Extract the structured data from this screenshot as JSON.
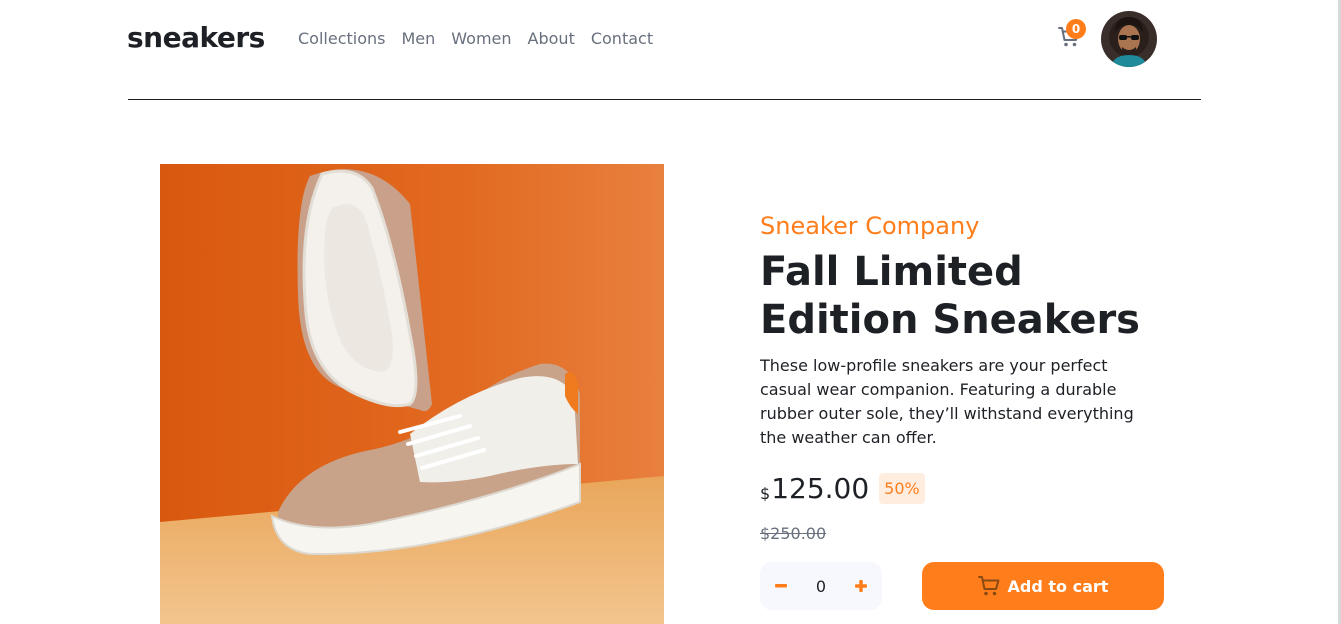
{
  "header": {
    "logo": "sneakers",
    "nav": [
      "Collections",
      "Men",
      "Women",
      "About",
      "Contact"
    ],
    "cart_count": "0"
  },
  "product": {
    "company": "Sneaker Company",
    "title": "Fall Limited Edition Sneakers",
    "description": "These low-profile sneakers are your perfect casual wear companion. Featuring a durable rubber outer sole, they’ll withstand everything the weather can offer.",
    "currency": "$",
    "price": "125.00",
    "discount": "50%",
    "old_price": "$250.00",
    "quantity": "0",
    "add_to_cart_label": "Add to cart"
  },
  "colors": {
    "accent": "#ff7e1b",
    "accent_pale": "#ffede0",
    "text_dark": "#1d2025",
    "text_gray": "#68707d"
  },
  "icons": [
    "cart-icon",
    "minus-icon",
    "plus-icon"
  ]
}
